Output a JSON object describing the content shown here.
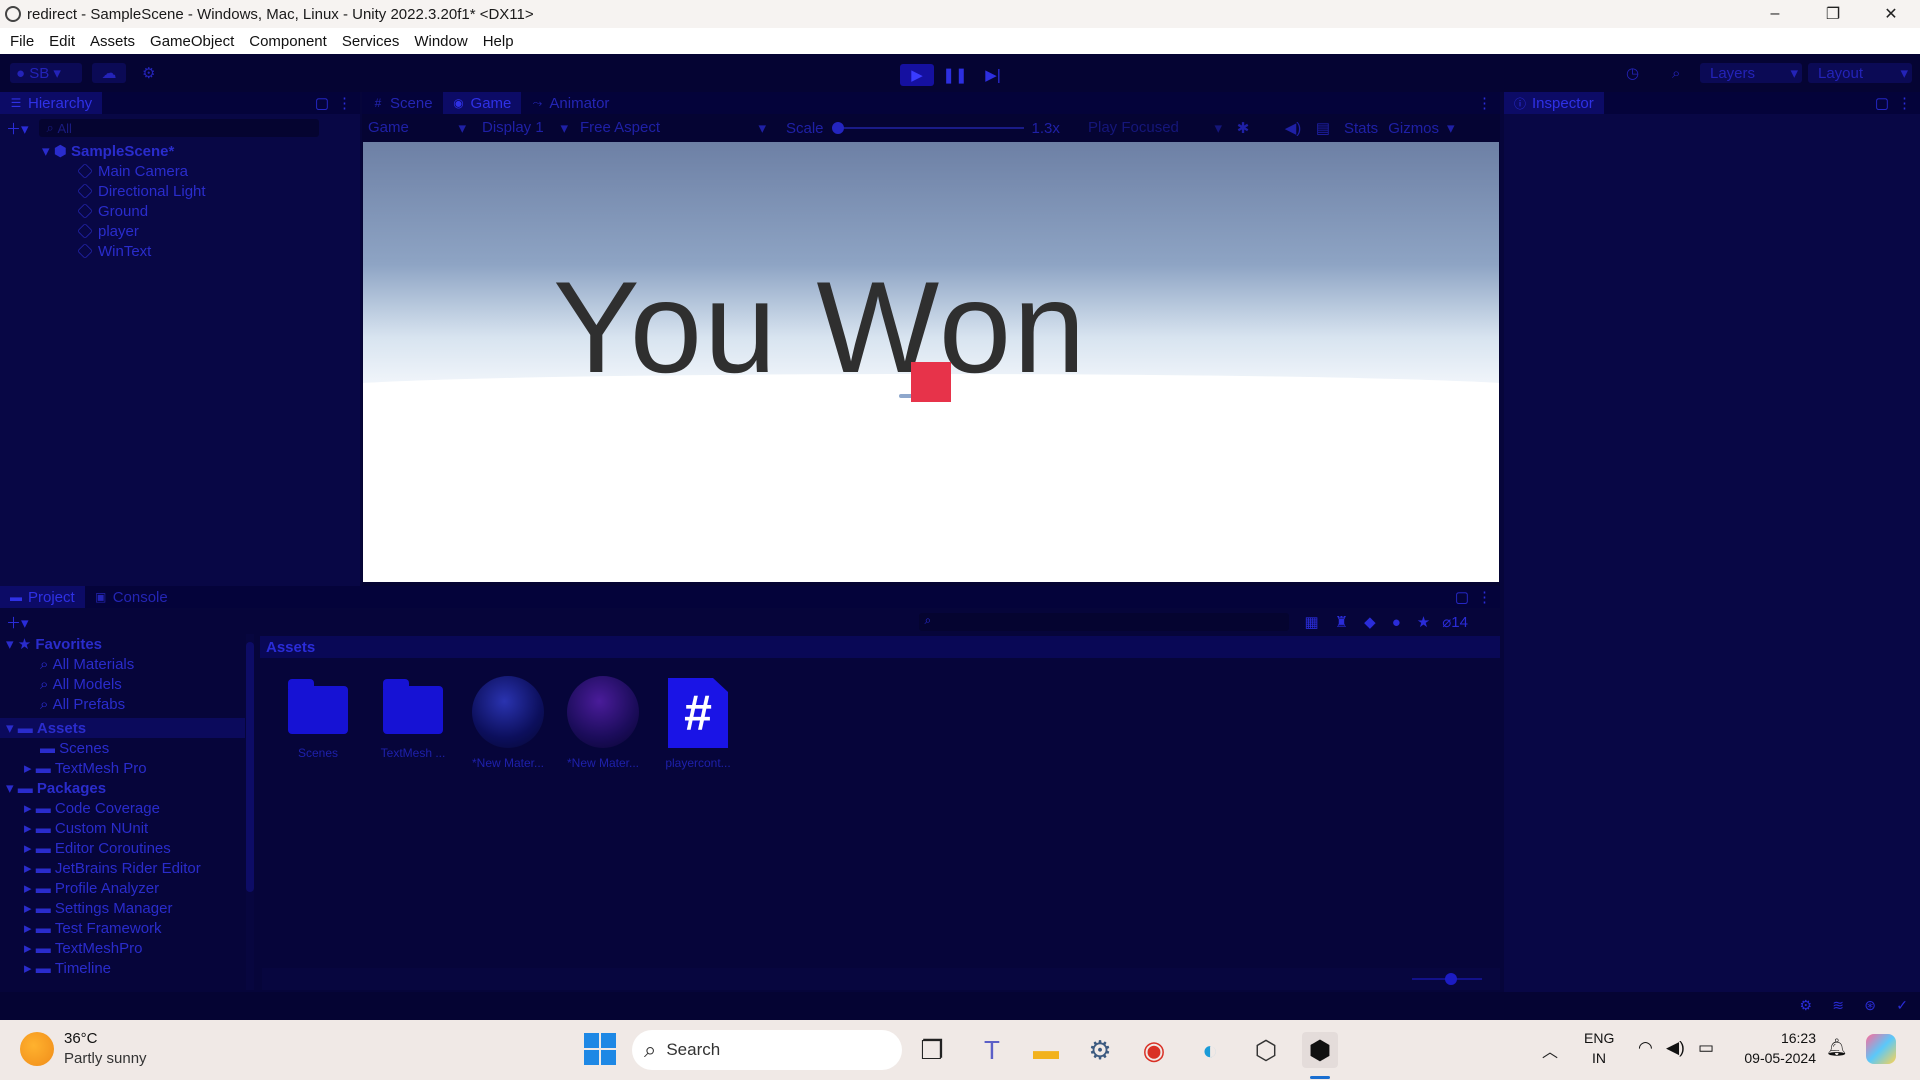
{
  "window": {
    "title": "redirect - SampleScene - Windows, Mac, Linux - Unity 2022.3.20f1* <DX11>",
    "controls": [
      "–",
      "❐",
      "✕"
    ]
  },
  "menubar": [
    "File",
    "Edit",
    "Assets",
    "GameObject",
    "Component",
    "Services",
    "Window",
    "Help"
  ],
  "toolbar": {
    "account": "SB",
    "layers": "Layers",
    "layout": "Layout"
  },
  "hierarchy": {
    "tab": "Hierarchy",
    "search_placeholder": "All",
    "scene": "SampleScene*",
    "objects": [
      "Main Camera",
      "Directional Light",
      "Ground",
      "player",
      "WinText"
    ]
  },
  "center_tabs": [
    "Scene",
    "Game",
    "Animator"
  ],
  "game_toolbar": {
    "mode": "Game",
    "display": "Display 1",
    "aspect": "Free Aspect",
    "scale_label": "Scale",
    "scale_value": "1.3x",
    "play_mode": "Play Focused",
    "stats": "Stats",
    "gizmos": "Gizmos"
  },
  "game_view": {
    "text": "You Won"
  },
  "inspector": {
    "tab": "Inspector"
  },
  "project": {
    "tabs": [
      "Project",
      "Console"
    ],
    "hidden_count": "14",
    "favorites_label": "Favorites",
    "favorites": [
      "All Materials",
      "All Models",
      "All Prefabs"
    ],
    "assets_label": "Assets",
    "assets_children": [
      "Scenes",
      "TextMesh Pro"
    ],
    "packages_label": "Packages",
    "packages": [
      "Code Coverage",
      "Custom NUnit",
      "Editor Coroutines",
      "JetBrains Rider Editor",
      "Profile Analyzer",
      "Settings Manager",
      "Test Framework",
      "TextMeshPro",
      "Timeline"
    ],
    "breadcrumb": "Assets",
    "grid": [
      "Scenes",
      "TextMesh ...",
      "*New Mater...",
      "*New Mater...",
      "playercont..."
    ]
  },
  "taskbar": {
    "weather_temp": "36°C",
    "weather_desc": "Partly sunny",
    "search": "Search",
    "lang_top": "ENG",
    "lang_bottom": "IN",
    "time": "16:23",
    "date": "09-05-2024"
  },
  "colors": {
    "editor_bg": "#080745",
    "text_tint": "#2a2ccc",
    "player_cube": "#e7334a",
    "taskbar_bg": "#f0e9e6"
  }
}
